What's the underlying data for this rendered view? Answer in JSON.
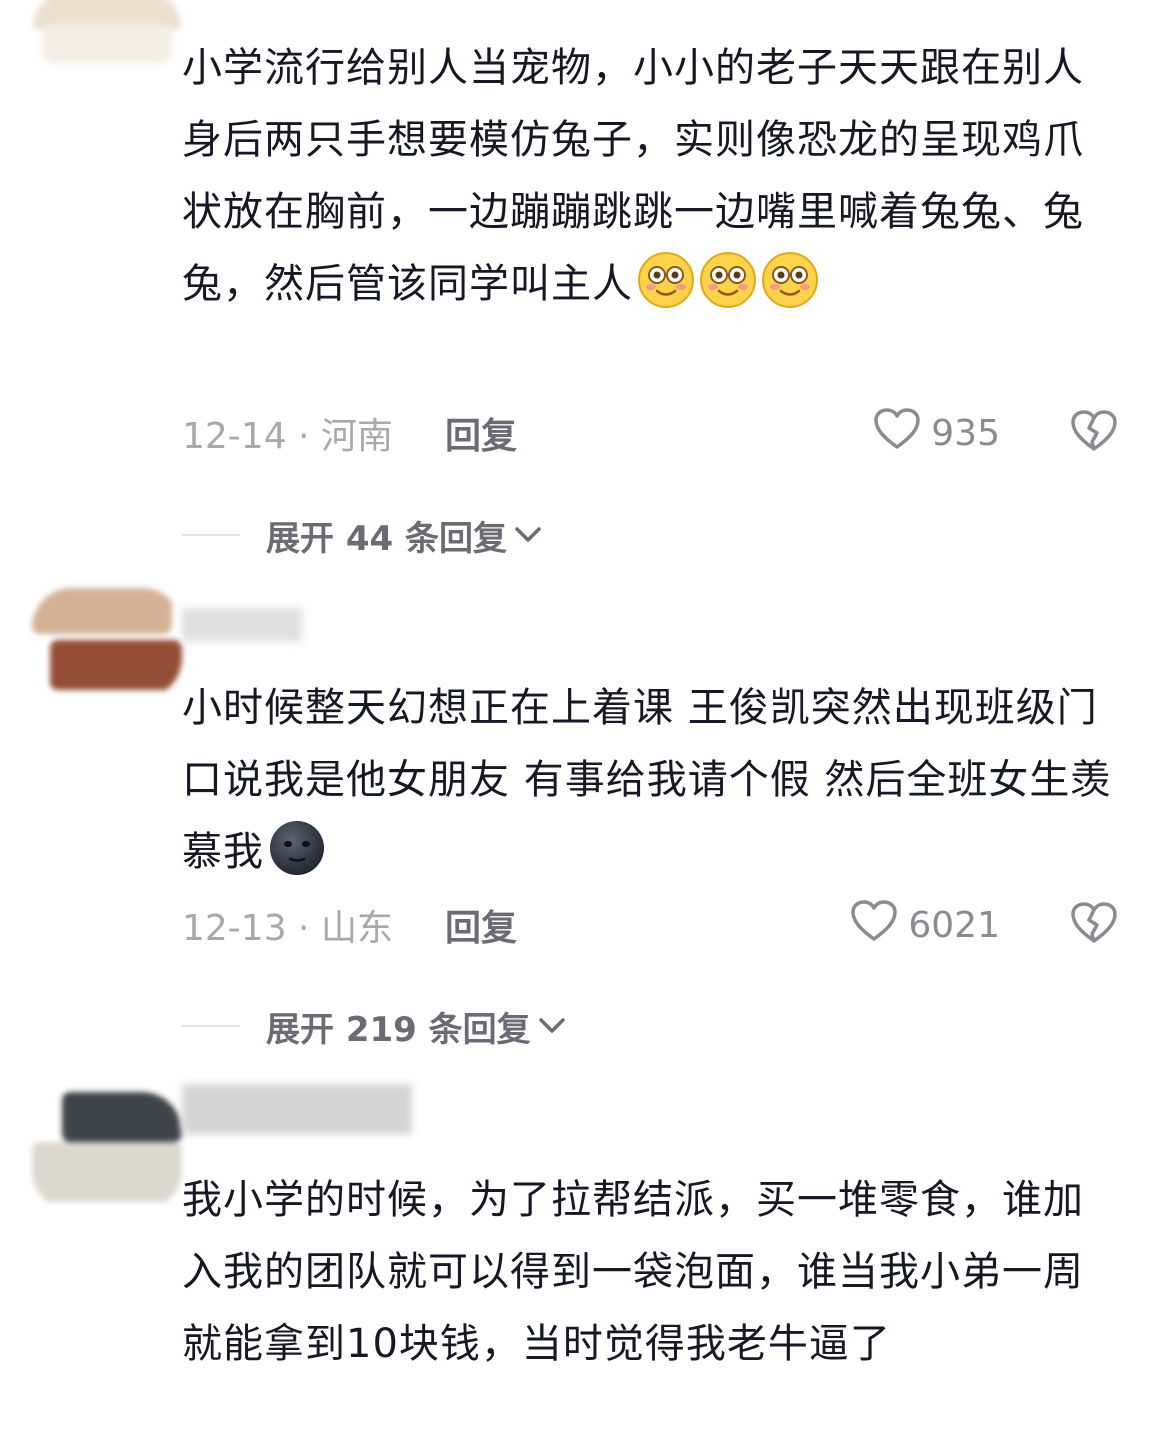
{
  "comments": [
    {
      "text": "小学流行给别人当宠物，小小的老子天天跟在别人身后两只手想要模仿兔子，实则像恐龙的呈现鸡爪状放在胸前，一边蹦蹦跳跳一边嘴里喊着兔兔、兔兔，然后管该同学叫主人",
      "emojis": [
        "flushed-face",
        "flushed-face",
        "flushed-face"
      ],
      "date_location": "12-14 · 河南",
      "reply_label": "回复",
      "likes": "935",
      "expand_label": "展开 44 条回复"
    },
    {
      "text": "小时候整天幻想正在上着课 王俊凯突然出现班级门口说我是他女朋友 有事给我请个假 然后全班女生羡慕我",
      "emojis": [
        "new-moon-face"
      ],
      "date_location": "12-13 · 山东",
      "reply_label": "回复",
      "likes": "6021",
      "expand_label": "展开 219 条回复"
    },
    {
      "text": "我小学的时候，为了拉帮结派，买一堆零食，谁加入我的团队就可以得到一袋泡面，谁当我小弟一周就能拿到10块钱，当时觉得我老牛逼了"
    }
  ],
  "colors": {
    "text": "#161823",
    "meta": "#a8a9ad",
    "reply": "#6a6b73",
    "icon": "#8a8b91"
  }
}
